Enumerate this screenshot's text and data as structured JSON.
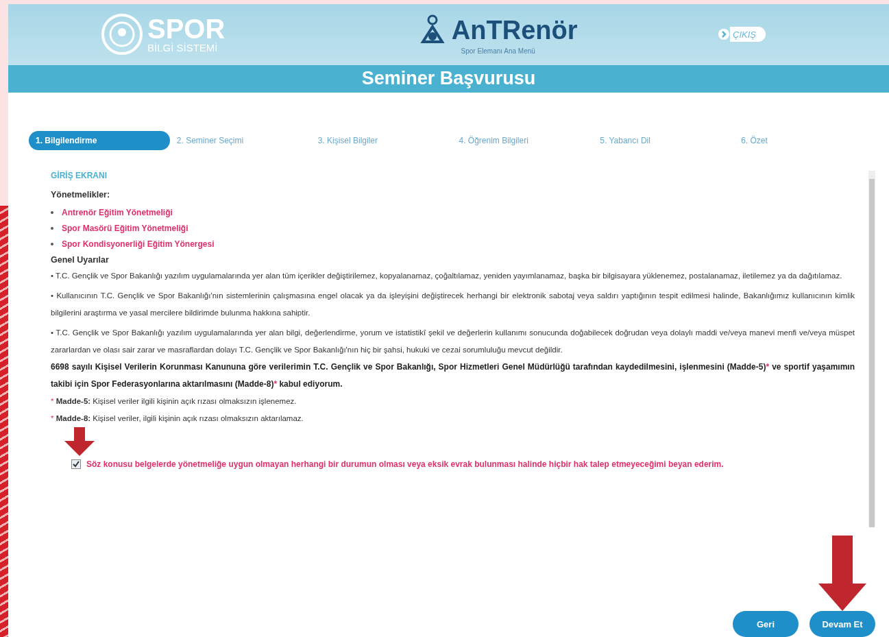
{
  "header": {
    "left_logo": {
      "title": "SPOR",
      "subtitle": "BİLGİ SİSTEMİ"
    },
    "center_logo": {
      "title": "AnTRenör",
      "subtitle": "Spor Elemanı Ana Menü"
    },
    "exit_button": "ÇIKIŞ"
  },
  "page_title": "Seminer Başvurusu",
  "steps": [
    {
      "label": "1. Bilgilendirme",
      "selected": true
    },
    {
      "label": "2. Seminer Seçimi",
      "selected": false
    },
    {
      "label": "3. Kişisel Bilgiler",
      "selected": false
    },
    {
      "label": "4. Öğrenim Bilgileri",
      "selected": false
    },
    {
      "label": "5. Yabancı Dil",
      "selected": false
    },
    {
      "label": "6. Özet",
      "selected": false
    }
  ],
  "content": {
    "heading": "GİRİŞ EKRANI",
    "regulations_title": "Yönetmelikler:",
    "regulations": [
      "Antrenör Eğitim Yönetmeliği",
      "Spor Masörü Eğitim Yönetmeliği",
      "Spor Kondisyonerliği Eğitim Yönergesi"
    ],
    "warnings_title": "Genel Uyarılar",
    "warnings": [
      "• T.C. Gençlik ve Spor Bakanlığı yazılım uygulamalarında yer alan tüm içerikler değiştirilemez, kopyalanamaz, çoğaltılamaz, yeniden yayımlanamaz, başka bir bilgisayara yüklenemez, postalanamaz, iletilemez ya da dağıtılamaz.",
      "• Kullanıcının T.C. Gençlik ve Spor Bakanlığı'nın sistemlerinin çalışmasına engel olacak ya da işleyişini değiştirecek herhangi bir elektronik sabotaj veya saldırı yaptığının tespit edilmesi halinde, Bakanlığımız kullanıcının kimlik bilgilerini araştırma ve yasal mercilere bildirimde bulunma hakkına sahiptir.",
      "• T.C. Gençlik ve Spor Bakanlığı yazılım uygulamalarında yer alan bilgi, değerlendirme, yorum ve istatistikî şekil ve değerlerin kullanımı sonucunda doğabilecek doğrudan veya dolaylı maddi ve/veya manevi menfi ve/veya müspet zararlardan ve olası sair zarar ve masraflardan dolayı T.C. Gençlik ve Spor Bakanlığı'nın hiç bir şahsi, hukuki ve cezai sorumluluğu mevcut değildir."
    ],
    "consent_parts": [
      {
        "kind": "text",
        "text": "6698 sayılı Kişisel Verilerin Korunması Kanununa göre verilerimin T.C. Gençlik ve Spor Bakanlığı, Spor Hizmetleri Genel Müdürlüğü tarafından kaydedilmesini, işlenmesini (Madde-5)"
      },
      {
        "kind": "mark",
        "text": "*"
      },
      {
        "kind": "text",
        "text": " ve sportif yaşamımın takibi için Spor Federasyonlarına aktarılmasını (Madde-8)"
      },
      {
        "kind": "mark",
        "text": "*"
      },
      {
        "kind": "text",
        "text": " kabul ediyorum."
      }
    ],
    "footnotes": [
      {
        "mark": "*",
        "term": "Madde-5:",
        "text": "Kişisel veriler ilgili kişinin açık rızası olmaksızın işlenemez."
      },
      {
        "mark": "*",
        "term": "Madde-8:",
        "text": "Kişisel veriler, ilgili kişinin açık rızası olmaksızın aktarılamaz."
      }
    ]
  },
  "agreement": {
    "checked": true,
    "text": "Söz konusu belgelerde yönetmeliğe uygun olmayan herhangi bir durumun olması veya eksik evrak bulunması halinde hiçbir hak talep etmeyeceğimi beyan ederim."
  },
  "buttons": [
    "Geri",
    "Devam Et"
  ]
}
